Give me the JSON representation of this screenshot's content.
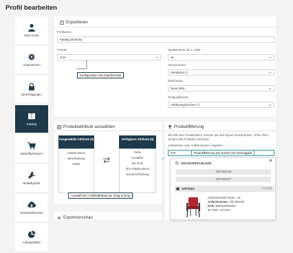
{
  "page_title": "Profil bearbeiten",
  "sidebar": [
    {
      "label": "Mein Konto",
      "icon": "user-icon"
    },
    {
      "label": "Unternehmen",
      "icon": "gear-icon"
    },
    {
      "label": "Berechtigungen",
      "icon": "lock-icon"
    },
    {
      "label": "Katalog",
      "icon": "book-icon",
      "active": true
    },
    {
      "label": "Bestellfunktionen",
      "icon": "cart-icon"
    },
    {
      "label": "Bestellgeräte",
      "icon": "wrench-icon"
    },
    {
      "label": "Downloadzentrum",
      "icon": "download-icon"
    },
    {
      "label": "Auftragsdaten",
      "icon": "chart-icon"
    }
  ],
  "export": {
    "heading": "Exportieren",
    "profile_label": "Profilname:",
    "profile_value": "Katalog Montana",
    "format_label": "Format:",
    "format_value": "CSV",
    "columns_label": "Spaltenname als 1. Zeile:",
    "columns_value": "Ja",
    "separator_label": "Trennzeichen:",
    "separator_value": "Semikolon (;)",
    "line_end_label": "Zeilenende:",
    "line_end_value": "Neue Zeile",
    "qualifier_label": "Textqualifizierer:",
    "qualifier_value": "Anführungszeichen (\")",
    "callout": "Konfiguration des Dateiformats"
  },
  "attributes": {
    "heading": "Produktattribute auswählen",
    "selected_header": "Ausgewählte Attribute (3)",
    "selected_items": [
      "Artikelnummer",
      "Beschreibung",
      "Name"
    ],
    "available_header": "Verfügbare Attribute (5)",
    "available_items": [
      "Farbe",
      "Hersteller",
      "EK Preis",
      "Ihre Artikelnummer",
      "Kurzbeschreibung"
    ],
    "callout": "Auswahl der Artikelattribute per Drag & Drop"
  },
  "filter": {
    "heading": "Produktfilterung",
    "description": "Mit Hilfe des Produktfilters, können Sie den Export einschränken. Ohne Filter werden alle Produkte exportiert.",
    "input_label": "Artikelname oder Artikelnummer eingeben",
    "input_value": "200",
    "callout": "Produktfilterung per Suche mit Autosuggest",
    "suggestions_title": "SUCHVORSCHLÄGE",
    "suggestions": [
      "200-654236",
      "200-654237"
    ],
    "articles_title": "ARTIKEL",
    "articles_count": "1-9 (749)",
    "article": {
      "name": "Konferenzstuhl Texas - rot",
      "number_label": "Artikelnummer:",
      "number": "200-654240",
      "ean_label": "EAN:",
      "ean": "3654425465482",
      "price": "Ihr Preis: 137.50 €"
    }
  },
  "bottom_card_heading": "Exportvorschau",
  "colors": {
    "primary": "#1e3a4c",
    "accent": "#2a9d8f",
    "background": "#f3f3f3"
  }
}
